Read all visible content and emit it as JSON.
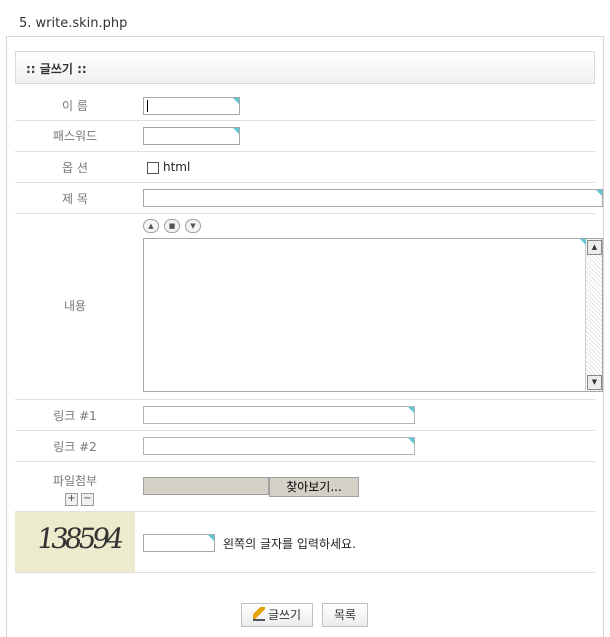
{
  "caption": "5. write.skin.php",
  "form": {
    "title": ":: 글쓰기 ::",
    "name_label": "이 름",
    "password_label": "패스워드",
    "option_label": "옵 션",
    "option_html_label": "html",
    "subject_label": "제 목",
    "content_label": "내용",
    "link1_label": "링크 #1",
    "link2_label": "링크 #2",
    "file_label": "파일첨부",
    "file_add": "+",
    "file_remove": "−",
    "browse_label": "찾아보기...",
    "captcha_code": "138594",
    "captcha_hint": "왼쪽의 글자를 입력하세요.",
    "size_up": "▲",
    "size_reset": "■",
    "size_down": "▼"
  },
  "buttons": {
    "write": "글쓰기",
    "list": "목록"
  }
}
